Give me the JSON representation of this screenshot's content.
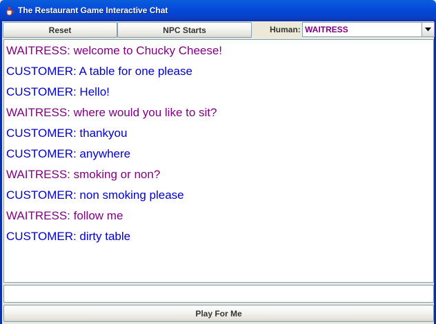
{
  "window": {
    "title": "The Restaurant Game Interactive Chat",
    "icon": "java-cup-icon"
  },
  "toolbar": {
    "reset_label": "Reset",
    "npc_starts_label": "NPC Starts",
    "human_label": "Human:",
    "human_selected": "WAITRESS",
    "dropdown_icon": "chevron-down-icon"
  },
  "chat": {
    "lines": [
      {
        "speaker": "WAITRESS",
        "text": "WAITRESS: welcome to Chucky Cheese!"
      },
      {
        "speaker": "CUSTOMER",
        "text": "CUSTOMER: A table for one please"
      },
      {
        "speaker": "CUSTOMER",
        "text": "CUSTOMER: Hello!"
      },
      {
        "speaker": "WAITRESS",
        "text": "WAITRESS: where would you like to sit?"
      },
      {
        "speaker": "CUSTOMER",
        "text": "CUSTOMER: thankyou"
      },
      {
        "speaker": "CUSTOMER",
        "text": "CUSTOMER: anywhere"
      },
      {
        "speaker": "WAITRESS",
        "text": "WAITRESS: smoking or non?"
      },
      {
        "speaker": "CUSTOMER",
        "text": "CUSTOMER: non smoking please"
      },
      {
        "speaker": "WAITRESS",
        "text": "WAITRESS: follow me"
      },
      {
        "speaker": "CUSTOMER",
        "text": "CUSTOMER: dirty table"
      }
    ]
  },
  "input": {
    "value": ""
  },
  "footer": {
    "play_label": "Play For Me"
  },
  "colors": {
    "waitress": "#800080",
    "customer": "#0000cc",
    "titlebar": "#0346d6"
  }
}
